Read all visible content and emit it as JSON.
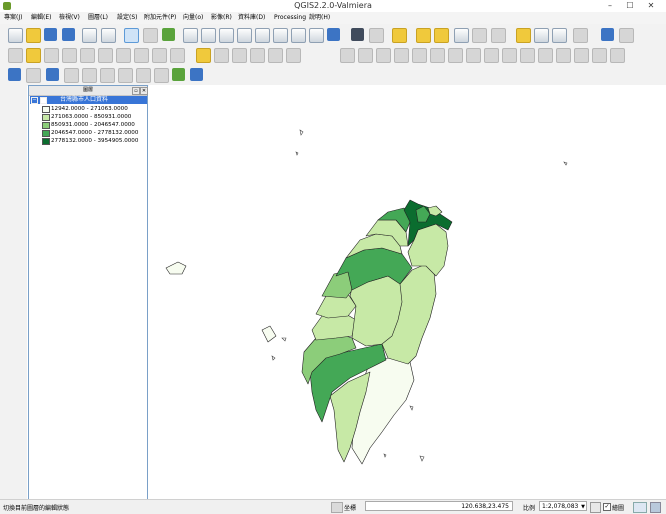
{
  "window": {
    "title": "QGIS2.2.0-Valmiera",
    "min": "–",
    "max": "☐",
    "close": "✕"
  },
  "menu": [
    "專案(J)",
    "編輯(E)",
    "檢視(V)",
    "圖層(L)",
    "設定(S)",
    "附加元件(P)",
    "向量(o)",
    "影像(R)",
    "資料庫(D)",
    "Processing",
    "說明(H)"
  ],
  "layers_panel": {
    "title": "圖層",
    "float_button": "▫",
    "close_button": "✕",
    "layer": {
      "name": "台灣縣市人口資料",
      "expand": "−",
      "visible": true,
      "classes": [
        {
          "label": "12942.0000 - 271063.0000",
          "color": "#f7fcf0"
        },
        {
          "label": "271063.0000 - 850931.0000",
          "color": "#c7e9a6"
        },
        {
          "label": "850931.0000 - 2046547.0000",
          "color": "#8ccd7a"
        },
        {
          "label": "2046547.0000 - 2778132.0000",
          "color": "#44a856"
        },
        {
          "label": "2778132.0000 - 3954905.0000",
          "color": "#0b6d2f"
        }
      ]
    }
  },
  "map": {
    "counties": [
      {
        "name": "Keelung",
        "class": 1
      },
      {
        "name": "Taipei",
        "class": 3
      },
      {
        "name": "New Taipei",
        "class": 4
      },
      {
        "name": "Yilan",
        "class": 1
      },
      {
        "name": "Taoyuan",
        "class": 3
      },
      {
        "name": "Hsinchu",
        "class": 1
      },
      {
        "name": "Miaoli",
        "class": 1
      },
      {
        "name": "Taichung",
        "class": 3
      },
      {
        "name": "Nantou",
        "class": 1
      },
      {
        "name": "Hualien",
        "class": 1
      },
      {
        "name": "Changhua",
        "class": 2
      },
      {
        "name": "Yunlin",
        "class": 1
      },
      {
        "name": "Chiayi",
        "class": 1
      },
      {
        "name": "Tainan",
        "class": 2
      },
      {
        "name": "Kaohsiung",
        "class": 3
      },
      {
        "name": "Taitung",
        "class": 0
      },
      {
        "name": "Pingtung",
        "class": 1
      },
      {
        "name": "Penghu",
        "class": 0
      },
      {
        "name": "Kinmen",
        "class": 0
      }
    ]
  },
  "status": {
    "message": "切換目前圖層的編輯狀態",
    "coord_label": "坐標",
    "coordinates": "120.638,23.475",
    "scale_label": "比例",
    "scale_value": "1:2,078,083",
    "render_label": "繪圖",
    "render_checked": "✓"
  }
}
